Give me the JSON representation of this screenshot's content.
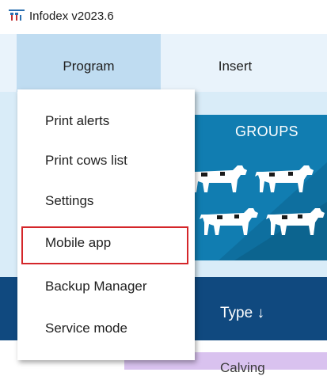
{
  "window": {
    "title": "Infodex v2023.6",
    "icon": "cow-herd-app-icon"
  },
  "ribbon": {
    "tabs": [
      {
        "label": "Program",
        "active": true
      },
      {
        "label": "Insert",
        "active": false
      }
    ]
  },
  "program_menu": {
    "items": [
      {
        "label": "Print alerts"
      },
      {
        "label": "Print cows list"
      },
      {
        "label": "Settings"
      },
      {
        "label": "Mobile app",
        "highlighted": true
      },
      {
        "label": "Backup Manager"
      },
      {
        "label": "Service mode"
      }
    ],
    "highlight_color": "#d4262a"
  },
  "tiles": {
    "groups_label": "GROUPS",
    "groups_color": "#117db1",
    "type_header": "Type ↓",
    "type_band_color": "#10497f",
    "calving_label": "Calving",
    "calving_color": "#d9c2ef"
  },
  "colors": {
    "ribbon_bg": "#e9f3fb",
    "active_tab_bg": "#bfdcf1",
    "content_bg": "#d9ecf8"
  }
}
